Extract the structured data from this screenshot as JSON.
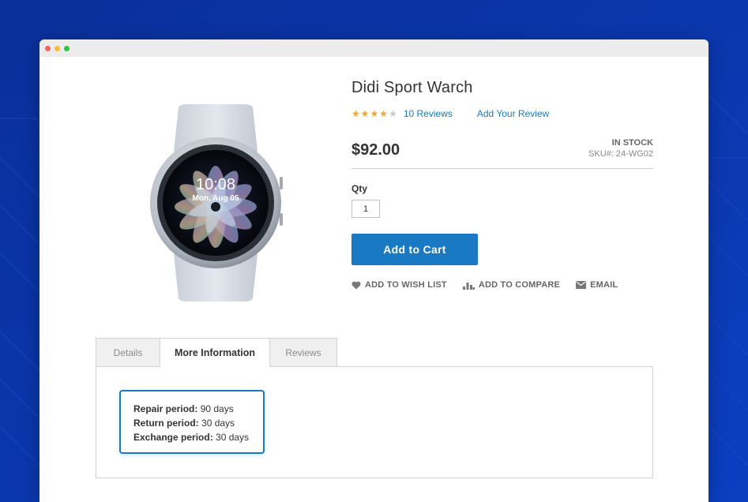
{
  "colors": {
    "background": "#0a37a8",
    "accent": "#1979c3",
    "star": "#f6a623"
  },
  "product": {
    "name": "Didi Sport Warch",
    "rating": 4,
    "rating_max": 5,
    "reviews_label": "10 Reviews",
    "add_review_label": "Add Your Review",
    "price": "$92.00",
    "stock_status": "IN STOCK",
    "sku": "SKU#: 24-WG02",
    "watch_time": "10:08",
    "watch_date": "Mon, Aug 05"
  },
  "purchase": {
    "qty_label": "Qty",
    "qty_value": "1",
    "add_to_cart_label": "Add to Cart"
  },
  "actions": [
    {
      "label": "ADD TO WISH LIST",
      "icon": "heart-icon"
    },
    {
      "label": "ADD TO COMPARE",
      "icon": "compare-icon"
    },
    {
      "label": "EMAIL",
      "icon": "envelope-icon"
    }
  ],
  "tabs": [
    {
      "label": "Details",
      "active": false
    },
    {
      "label": "More Information",
      "active": true
    },
    {
      "label": "Reviews",
      "active": false
    }
  ],
  "more_info": [
    {
      "label": "Repair period:",
      "value": "90 days"
    },
    {
      "label": "Return period:",
      "value": "30 days"
    },
    {
      "label": "Exchange period:",
      "value": "30 days"
    }
  ]
}
